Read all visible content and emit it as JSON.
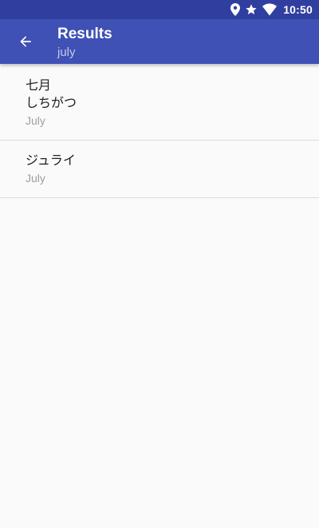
{
  "status_bar": {
    "time": "10:50",
    "icons": [
      "location-icon",
      "star-icon",
      "wifi-icon"
    ]
  },
  "app_bar": {
    "title": "Results",
    "subtitle": "july",
    "back_icon": "arrow-back-icon"
  },
  "colors": {
    "status_bar": "#303f9f",
    "app_bar": "#3f51b5",
    "background": "#fafafa",
    "primary_text": "#212121",
    "secondary_text": "#9e9e9e",
    "divider": "#dcdcdc"
  },
  "results": [
    {
      "term": "七月",
      "reading": "しちがつ",
      "meaning": "July"
    },
    {
      "term": "ジュライ",
      "reading": "",
      "meaning": "July"
    }
  ]
}
